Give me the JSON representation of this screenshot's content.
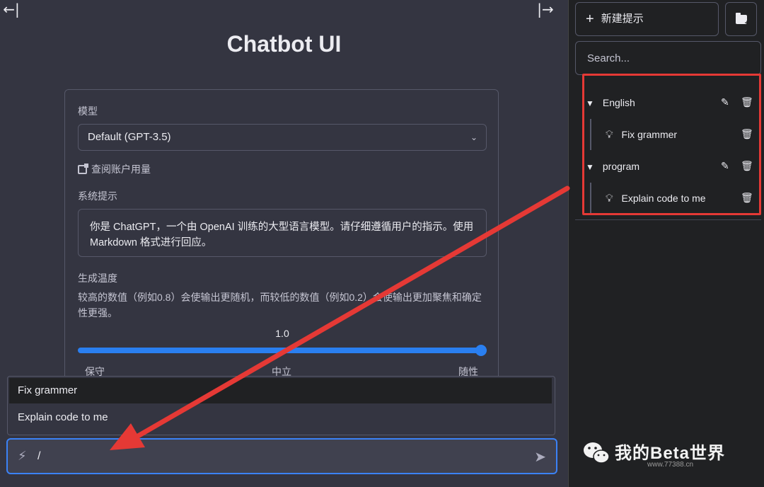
{
  "main": {
    "title": "Chatbot UI",
    "model_label": "模型",
    "model_value": "Default (GPT-3.5)",
    "usage_link": "查阅账户用量",
    "system_prompt_label": "系统提示",
    "system_prompt_text": "你是 ChatGPT，一个由 OpenAI 训练的大型语言模型。请仔细遵循用户的指示。使用 Markdown 格式进行回应。",
    "temperature_label": "生成温度",
    "temperature_desc": "较高的数值（例如0.8）会使输出更随机，而较低的数值（例如0.2）会使输出更加聚焦和确定性更强。",
    "temperature_value": "1.0",
    "temperature_level": 1.0,
    "scale_left": "保守",
    "scale_mid": "中立",
    "scale_right": "随性",
    "suggestions": [
      "Fix grammer",
      "Explain code to me"
    ],
    "input_value": "/",
    "collapse_left_icon": "←|",
    "collapse_right_icon": "|→"
  },
  "sidebar": {
    "new_prompt_label": "新建提示",
    "search_placeholder": "Search...",
    "folders": [
      {
        "name": "English",
        "prompts": [
          "Fix grammer"
        ]
      },
      {
        "name": "program",
        "prompts": [
          "Explain code to me"
        ]
      }
    ]
  },
  "watermark": {
    "text": "我的Beta世界",
    "url": "www.77388.cn"
  },
  "colors": {
    "accent": "#3b82f6",
    "highlight": "#e53935",
    "arrow": "#e53935"
  }
}
